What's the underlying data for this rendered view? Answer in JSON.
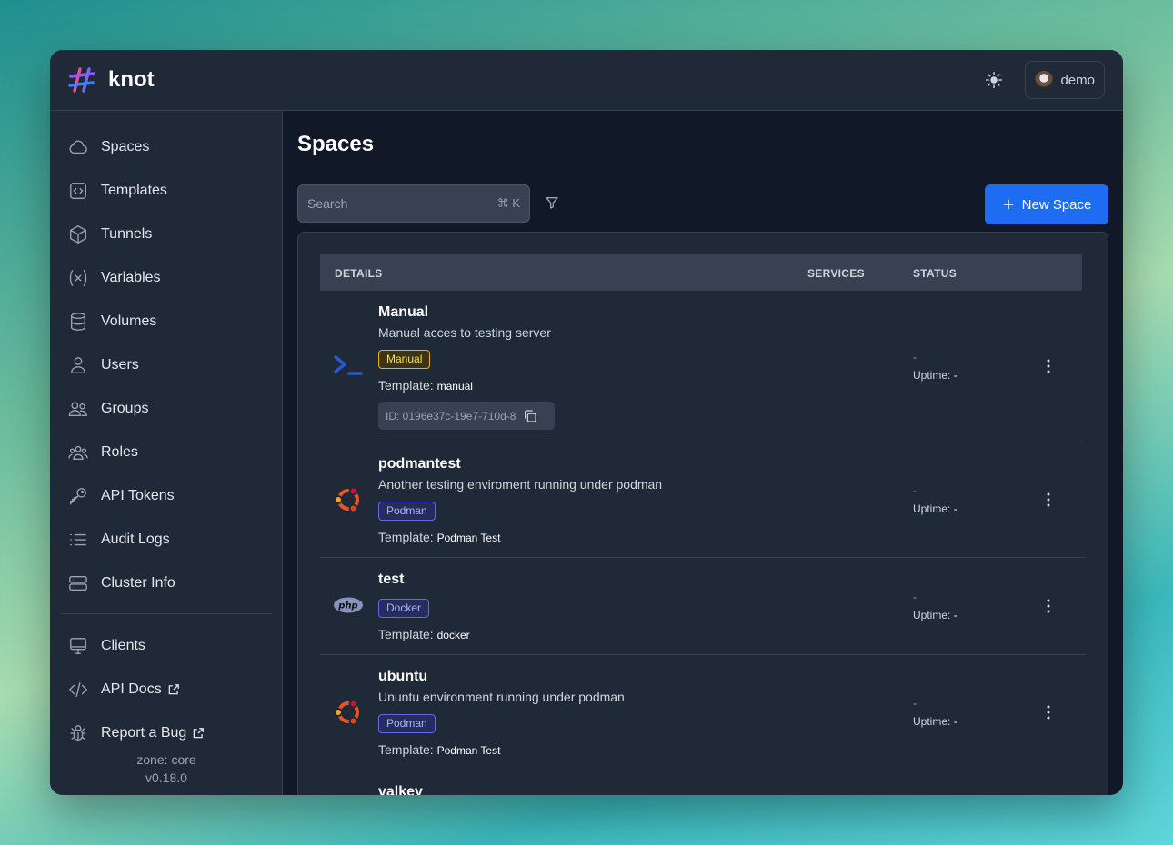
{
  "app": {
    "name": "knot"
  },
  "header": {
    "user_name": "demo"
  },
  "sidebar": {
    "items": [
      {
        "label": "Spaces",
        "icon": "cloud-icon"
      },
      {
        "label": "Templates",
        "icon": "code-file-icon"
      },
      {
        "label": "Tunnels",
        "icon": "cube-icon"
      },
      {
        "label": "Variables",
        "icon": "variable-icon"
      },
      {
        "label": "Volumes",
        "icon": "database-icon"
      },
      {
        "label": "Users",
        "icon": "user-icon"
      },
      {
        "label": "Groups",
        "icon": "users-icon"
      },
      {
        "label": "Roles",
        "icon": "roles-icon"
      },
      {
        "label": "API Tokens",
        "icon": "key-icon"
      },
      {
        "label": "Audit Logs",
        "icon": "list-icon"
      },
      {
        "label": "Cluster Info",
        "icon": "server-icon"
      }
    ],
    "secondary": [
      {
        "label": "Clients",
        "icon": "monitor-icon"
      },
      {
        "label": "API Docs",
        "icon": "code-icon"
      },
      {
        "label": "Report a Bug",
        "icon": "bug-icon"
      }
    ],
    "zone": "zone: core",
    "version": "v0.18.0"
  },
  "main": {
    "title": "Spaces",
    "search_placeholder": "Search",
    "search_shortcut": "⌘ K",
    "new_button": "New Space",
    "columns": {
      "details": "DETAILS",
      "services": "SERVICES",
      "status": "STATUS"
    },
    "template_label": "Template:",
    "uptime_label": "Uptime:",
    "spaces": [
      {
        "name": "Manual",
        "description": "Manual acces to testing server",
        "badge": "Manual",
        "template": "manual",
        "id": "ID: 0196e37c-19e7-710d-8",
        "status": "-",
        "uptime": "-"
      },
      {
        "name": "podmantest",
        "description": "Another testing enviroment running under podman",
        "badge": "Podman",
        "template": "Podman Test",
        "status": "-",
        "uptime": "-"
      },
      {
        "name": "test",
        "badge": "Docker",
        "template": "docker",
        "status": "-",
        "uptime": "-"
      },
      {
        "name": "ubuntu",
        "description": "Ununtu environment running under podman",
        "badge": "Podman",
        "template": "Podman Test",
        "status": "-",
        "uptime": "-"
      },
      {
        "name": "valkey"
      }
    ]
  },
  "colors": {
    "accent": "#1d6cf2",
    "background": "#111827",
    "panel": "#1f2937"
  }
}
